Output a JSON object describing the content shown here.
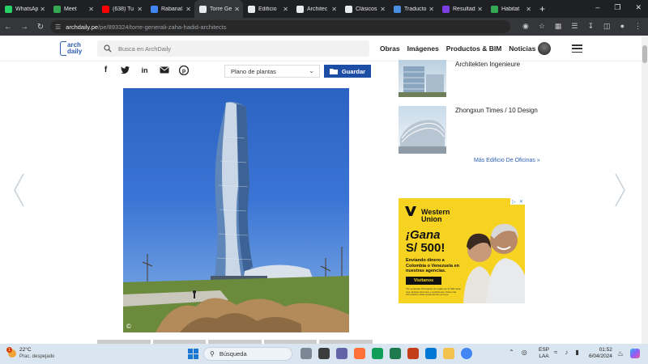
{
  "browser": {
    "tabs": [
      {
        "label": "WhatsApp",
        "favicon_color": "#25d366",
        "active": false
      },
      {
        "label": "Meet",
        "favicon_color": "#34a853",
        "active": false
      },
      {
        "label": "(638) Tu",
        "favicon_color": "#ff0000",
        "active": false
      },
      {
        "label": "Rabanal",
        "favicon_color": "#4285f4",
        "active": false
      },
      {
        "label": "Torre Ge",
        "favicon_color": "#e8eaed",
        "active": true
      },
      {
        "label": "Edificio",
        "favicon_color": "#e8eaed",
        "active": false
      },
      {
        "label": "Architec",
        "favicon_color": "#e8eaed",
        "active": false
      },
      {
        "label": "Clásicos",
        "favicon_color": "#e8eaed",
        "active": false
      },
      {
        "label": "Traducto",
        "favicon_color": "#4a90e2",
        "active": false
      },
      {
        "label": "Resultad",
        "favicon_color": "#7b3fe4",
        "active": false
      },
      {
        "label": "Habitat",
        "favicon_color": "#34a853",
        "active": false
      }
    ],
    "url_host": "archdaily.pe",
    "url_path": "/pe/893324/torre-generali-zaha-hadid-architects"
  },
  "site": {
    "logo_line1": "arch",
    "logo_line2": "daily",
    "search_placeholder": "Busca en ArchDaily",
    "nav": [
      "Obras",
      "Imágenes",
      "Productos & BIM",
      "Noticias"
    ]
  },
  "toolbar": {
    "plan_select": "Plano de plantas",
    "save_label": "Guardar"
  },
  "photo": {
    "copyright": "©"
  },
  "related": [
    {
      "title": "Architekten Ingenieure"
    },
    {
      "title": "Zhongxun Times / 10 Design"
    }
  ],
  "more_link": "Más Edificio De Oficinas »",
  "ad": {
    "brand_line1": "Western",
    "brand_line2": "Union",
    "headline1": "¡Gana",
    "headline2": "S/ 500!",
    "body": "Enviando dinero a Colombia o Venezuela en nuestras agencias.",
    "cta": "Visítanos",
    "fine_print": "*Se sortearán 50 tarjetas de regalo de S/ 500 cada una. Aplican términos y condiciones. Para más información visita westernunion.com.pe",
    "color": "#f7d321"
  },
  "taskbar": {
    "temp": "22°C",
    "weather": "Prac. despejado",
    "notification_count": "1",
    "search": "Búsqueda",
    "lang1": "ESP",
    "lang2": "LAA",
    "time": "01:52",
    "date": "6/04/2024"
  }
}
